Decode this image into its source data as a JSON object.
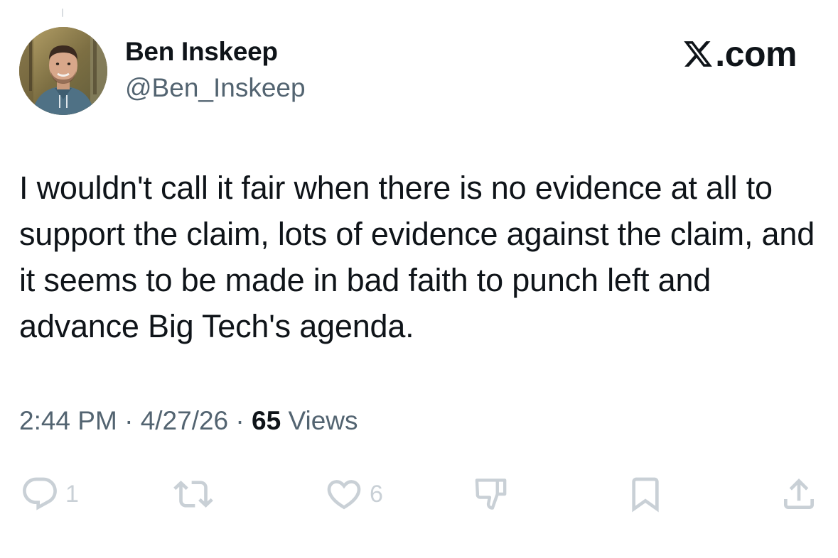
{
  "author": {
    "display_name": "Ben Inskeep",
    "handle": "@Ben_Inskeep",
    "avatar_icon": "profile-photo"
  },
  "brand": {
    "text": ".com",
    "icon": "x-logo-icon"
  },
  "tweet": {
    "text": "I wouldn't call it fair when there is no evidence at all to support the claim, lots of evidence against the claim, and it seems to be made in bad faith to punch left and advance Big Tech's agenda."
  },
  "meta": {
    "time": "2:44 PM",
    "separator": "·",
    "date": "4/27/26",
    "views_count": "65",
    "views_label": "Views"
  },
  "actions": {
    "reply": {
      "icon": "reply-icon",
      "count": "1"
    },
    "repost": {
      "icon": "repost-icon",
      "count": ""
    },
    "like": {
      "icon": "heart-icon",
      "count": "6"
    },
    "dislike": {
      "icon": "thumbs-down-icon",
      "count": ""
    },
    "bookmark": {
      "icon": "bookmark-icon",
      "count": ""
    },
    "share": {
      "icon": "share-icon",
      "count": ""
    }
  },
  "colors": {
    "text_primary": "#0f1419",
    "text_secondary": "#536471",
    "action_icon": "#c9d0d6",
    "background": "#ffffff"
  }
}
